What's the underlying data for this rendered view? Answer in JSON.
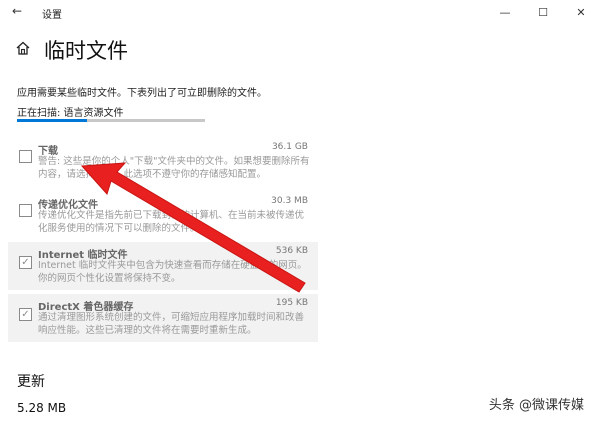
{
  "window": {
    "back_glyph": "←",
    "title": "设置",
    "minimize_glyph": "—",
    "maximize_glyph": "☐",
    "close_glyph": "✕"
  },
  "page": {
    "title": "临时文件",
    "description": "应用需要某些临时文件。下表列出了可立即删除的文件。",
    "scan_status": "正在扫描: 语言资源文件",
    "scan_progress_fraction": 0.37
  },
  "items": [
    {
      "name": "下载",
      "size": "36.1 GB",
      "description": "警告: 这些是你的个人\"下载\"文件夹中的文件。如果想要删除所有内容，请选择此项，此选项不遵守你的存储感知配置。",
      "checked": false
    },
    {
      "name": "传递优化文件",
      "size": "30.3 MB",
      "description": "传递优化文件是指先前已下载到你的计算机、在当前未被传递优化服务使用的情况下可以删除的文件。",
      "checked": false
    },
    {
      "name": "Internet 临时文件",
      "size": "536 KB",
      "description": "Internet 临时文件夹中包含为快速查看而存储在硬盘上的网页。你的网页个性化设置将保持不变。",
      "checked": true
    },
    {
      "name": "DirectX 着色器缓存",
      "size": "195 KB",
      "description": "通过清理图形系统创建的文件，可缩短应用程序加载时间和改善响应性能。这些已清理的文件将在需要时重新生成。",
      "checked": true
    }
  ],
  "section": {
    "title": "更新",
    "size": "5.28 MB"
  },
  "watermark": "头条 @微课传媒",
  "icons": {
    "home": "home-icon",
    "checkmark": "✓"
  },
  "colors": {
    "accent": "#0078d7",
    "arrow": "#e8201f"
  }
}
